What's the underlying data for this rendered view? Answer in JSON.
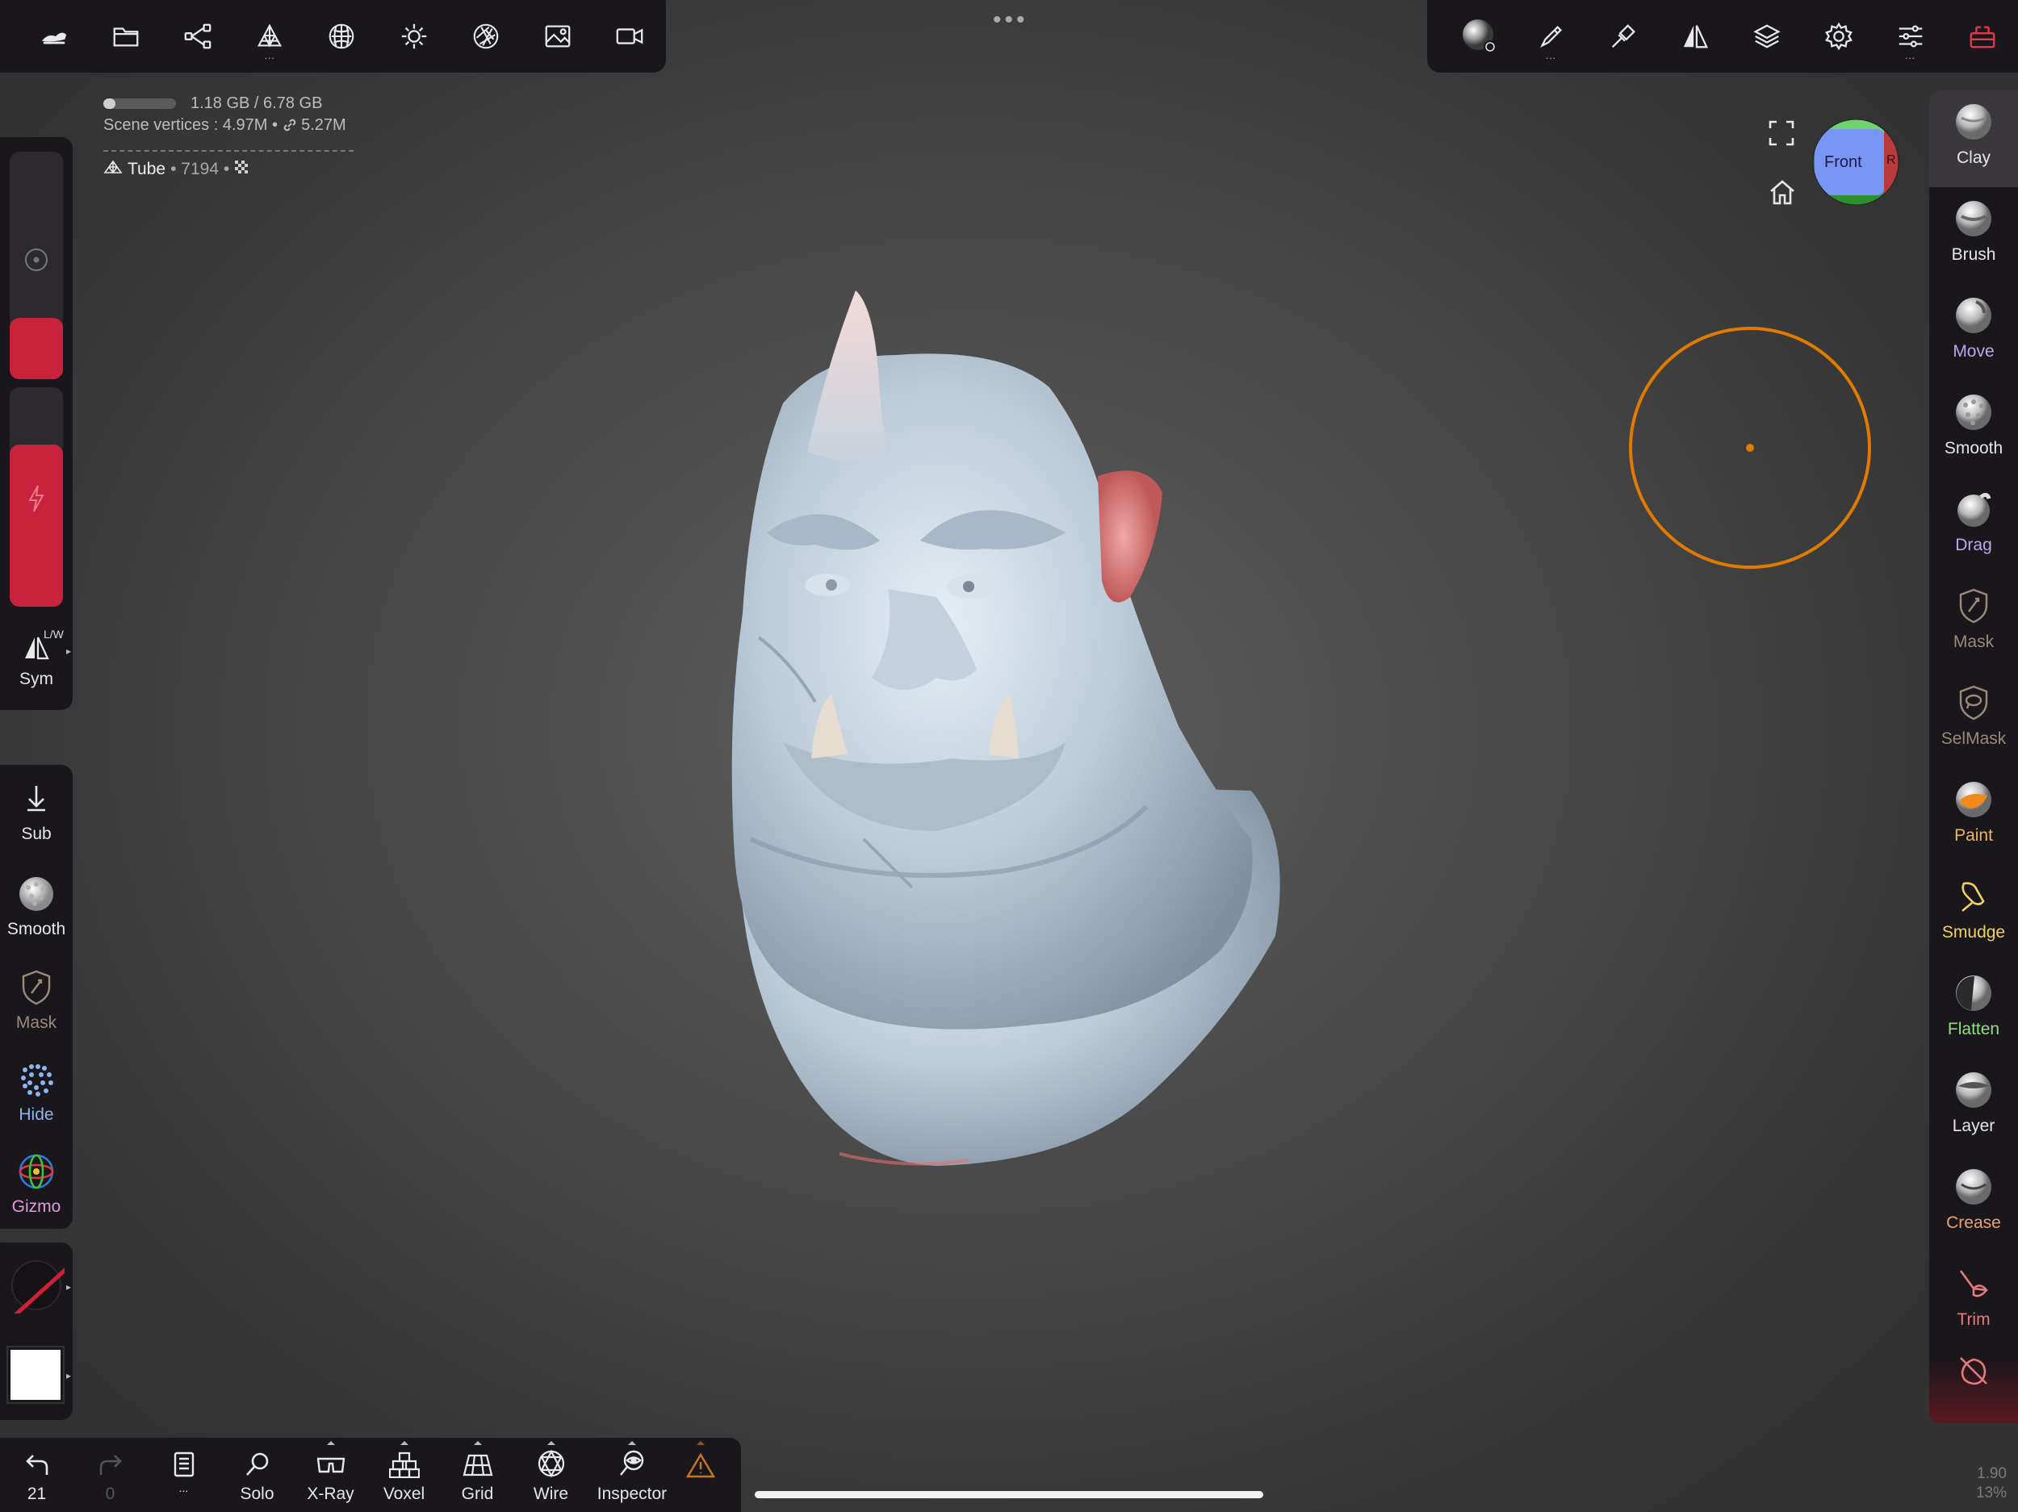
{
  "top_bar_left": {
    "tools": [
      {
        "name": "logo-icon"
      },
      {
        "name": "files-icon"
      },
      {
        "name": "scene-icon"
      },
      {
        "name": "topology-icon",
        "more": "..."
      },
      {
        "name": "material-icon"
      },
      {
        "name": "lighting-icon"
      },
      {
        "name": "postprocess-icon"
      },
      {
        "name": "background-icon"
      },
      {
        "name": "camera-icon"
      }
    ]
  },
  "center_menu": "•••",
  "top_bar_right": {
    "tools": [
      {
        "name": "material-ball-icon"
      },
      {
        "name": "painting-icon",
        "more": "..."
      },
      {
        "name": "stroke-icon"
      },
      {
        "name": "symmetry-icon"
      },
      {
        "name": "layers-icon"
      },
      {
        "name": "settings-icon"
      },
      {
        "name": "tool-settings-icon",
        "more": "..."
      },
      {
        "name": "interface-icon"
      }
    ]
  },
  "info": {
    "memory": "1.18 GB / 6.78 GB",
    "memory_fraction": 0.17,
    "vertices": "Scene vertices : 4.97M • ",
    "linked": "5.27M",
    "mesh_name": "Tube",
    "mesh_detail": " • 7194 • "
  },
  "left_sidebar": {
    "radius_fill": 0.27,
    "intensity_fill": 0.74,
    "sym_label": "Sym",
    "sym_badge": "L/W",
    "tools": [
      {
        "label": "Sub",
        "color": "#e6e6e6",
        "icon": "sub-arrow-icon"
      },
      {
        "label": "Smooth",
        "color": "#e6e6e6",
        "icon": "smooth-icon"
      },
      {
        "label": "Mask",
        "color": "#9a8a7a",
        "icon": "mask-icon"
      },
      {
        "label": "Hide",
        "color": "#8ab4f0",
        "icon": "hide-icon"
      },
      {
        "label": "Gizmo",
        "color": "#e59adf",
        "icon": "gizmo-icon"
      }
    ]
  },
  "right_tools": [
    {
      "label": "Clay",
      "color": "#e6e6e6"
    },
    {
      "label": "Brush",
      "color": "#e6e6e6"
    },
    {
      "label": "Move",
      "color": "#b9a8f0"
    },
    {
      "label": "Smooth",
      "color": "#e6e6e6"
    },
    {
      "label": "Drag",
      "color": "#b9a8f0"
    },
    {
      "label": "Mask",
      "color": "#9a8a7a"
    },
    {
      "label": "SelMask",
      "color": "#9a8a7a"
    },
    {
      "label": "Paint",
      "color": "#f0b35a"
    },
    {
      "label": "Smudge",
      "color": "#f2d15a"
    },
    {
      "label": "Flatten",
      "color": "#8fe07a"
    },
    {
      "label": "Layer",
      "color": "#e6e6e6"
    },
    {
      "label": "Crease",
      "color": "#f0a070"
    },
    {
      "label": "Trim",
      "color": "#e87a7a"
    },
    {
      "label": "",
      "color": "#e87a7a"
    }
  ],
  "bottom_bar": {
    "undo_count": "21",
    "redo_count": "0",
    "history_more": "...",
    "items": [
      {
        "label": "Solo",
        "caret": false
      },
      {
        "label": "X-Ray",
        "caret": true
      },
      {
        "label": "Voxel",
        "caret": true
      },
      {
        "label": "Grid",
        "caret": true
      },
      {
        "label": "Wire",
        "caret": true
      },
      {
        "label": "Inspector",
        "caret": true
      }
    ]
  },
  "view_cube": {
    "front_label": "Front",
    "right_label": "R"
  },
  "zoom": {
    "value": "1.90",
    "percent": "13%"
  },
  "colors": {
    "accent_red": "#c8223c",
    "brush_cursor": "#e07b00",
    "panel_bg": "#19171b"
  }
}
